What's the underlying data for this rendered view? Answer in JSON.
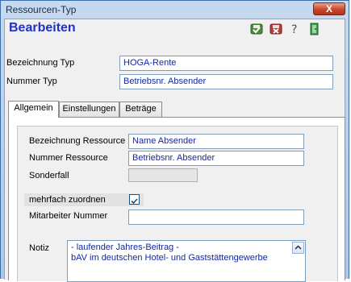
{
  "window": {
    "title": "Ressourcen-Typ",
    "close_symbol": "X"
  },
  "header": {
    "heading": "Bearbeiten"
  },
  "toolbar": [
    "save-icon",
    "cancel-icon",
    "help-icon",
    "exit-icon"
  ],
  "form": {
    "bezeichnung_typ": {
      "label": "Bezeichnung Typ",
      "value": "HOGA-Rente"
    },
    "nummer_typ": {
      "label": "Nummer Typ",
      "value": "Betriebsnr. Absender"
    }
  },
  "tabs": [
    {
      "label": "Allgemein",
      "active": true
    },
    {
      "label": "Einstellungen",
      "active": false
    },
    {
      "label": "Beträge",
      "active": false
    }
  ],
  "general": {
    "bezeichnung_ressource": {
      "label": "Bezeichnung Ressource",
      "value": "Name Absender"
    },
    "nummer_ressource": {
      "label": "Nummer Ressource",
      "value": "Betriebsnr. Absender"
    },
    "sonderfall": {
      "label": "Sonderfall",
      "value": ""
    },
    "mehrfach_zuordnen": {
      "label": "mehrfach zuordnen",
      "checked": true
    },
    "mitarbeiter_nummer": {
      "label": "Mitarbeiter Nummer",
      "value": ""
    },
    "notiz": {
      "label": "Notiz",
      "lines": [
        "- laufender Jahres-Beitrag -",
        "bAV im deutschen Hotel- und Gaststättengewerbe"
      ]
    }
  },
  "colors": {
    "heading": "#1f32c8",
    "field_text": "#1428a0",
    "title_bar": "#aec7e8",
    "close_button": "#c8462a"
  }
}
